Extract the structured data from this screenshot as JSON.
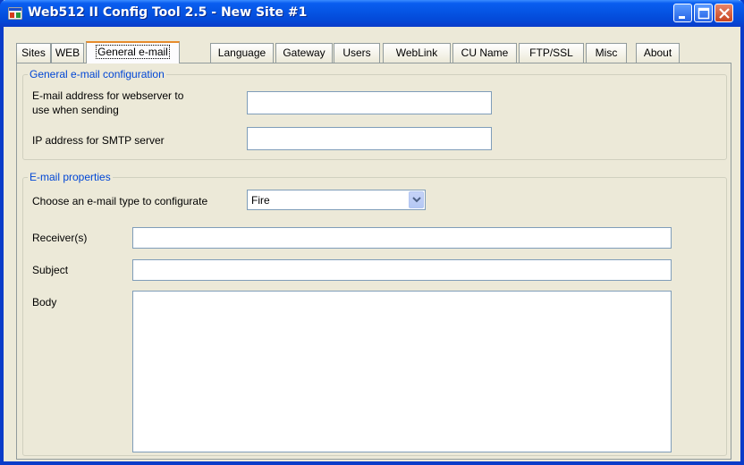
{
  "window": {
    "title": "Web512 II Config Tool 2.5 - New Site #1",
    "controls": [
      "minimize",
      "maximize",
      "close"
    ]
  },
  "tabs": [
    {
      "label": "Sites"
    },
    {
      "label": "WEB"
    },
    {
      "label": "General e-mail",
      "active": true
    },
    {
      "label": "Language"
    },
    {
      "label": "Gateway"
    },
    {
      "label": "Users"
    },
    {
      "label": "WebLink"
    },
    {
      "label": "CU Name"
    },
    {
      "label": "FTP/SSL"
    },
    {
      "label": "Misc"
    },
    {
      "label": "About"
    }
  ],
  "general_email": {
    "group_title": "General e-mail configuration",
    "sender_label_line1": "E-mail address for webserver to",
    "sender_label_line2": "use when sending",
    "sender_value": "",
    "smtp_label": "IP address for SMTP server",
    "smtp_value": ""
  },
  "email_properties": {
    "group_title": "E-mail properties",
    "type_label": "Choose an e-mail type to configurate",
    "type_value": "Fire",
    "receivers_label": "Receiver(s)",
    "receivers_value": "",
    "subject_label": "Subject",
    "subject_value": "",
    "body_label": "Body",
    "body_value": ""
  },
  "colors": {
    "titlebar": "#0554e3",
    "group_title": "#0046d5",
    "active_tab_accent": "#e68b2c",
    "face": "#ece9d8"
  }
}
